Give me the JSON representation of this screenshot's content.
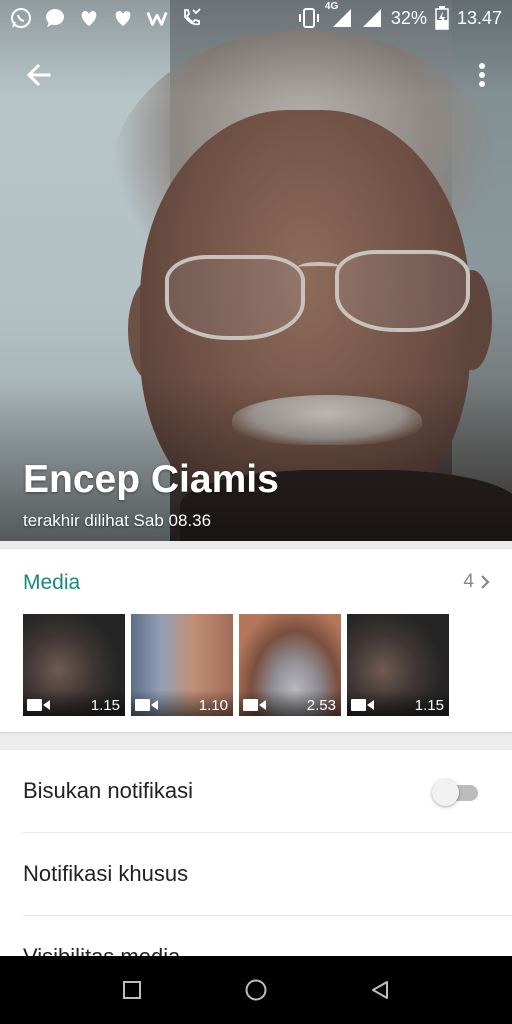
{
  "statusbar": {
    "network": "4G",
    "battery_pct": "32%",
    "time": "13.47",
    "notification_icons": [
      "whatsapp-icon",
      "chat-bubble-icon",
      "heart-icon",
      "heart-icon",
      "w-icon",
      "missed-call-icon"
    ]
  },
  "contact": {
    "name": "Encep Ciamis",
    "last_seen": "terakhir dilihat Sab 08.36"
  },
  "media": {
    "title": "Media",
    "count": "4",
    "items": [
      {
        "duration": "1.15"
      },
      {
        "duration": "1.10"
      },
      {
        "duration": "2.53"
      },
      {
        "duration": "1.15"
      }
    ]
  },
  "settings": {
    "mute_label": "Bisukan notifikasi",
    "mute_enabled": false,
    "custom_notif_label": "Notifikasi khusus",
    "media_visibility_label": "Visibilitas media"
  },
  "colors": {
    "accent": "#128c7e",
    "navbar": "#000000"
  }
}
